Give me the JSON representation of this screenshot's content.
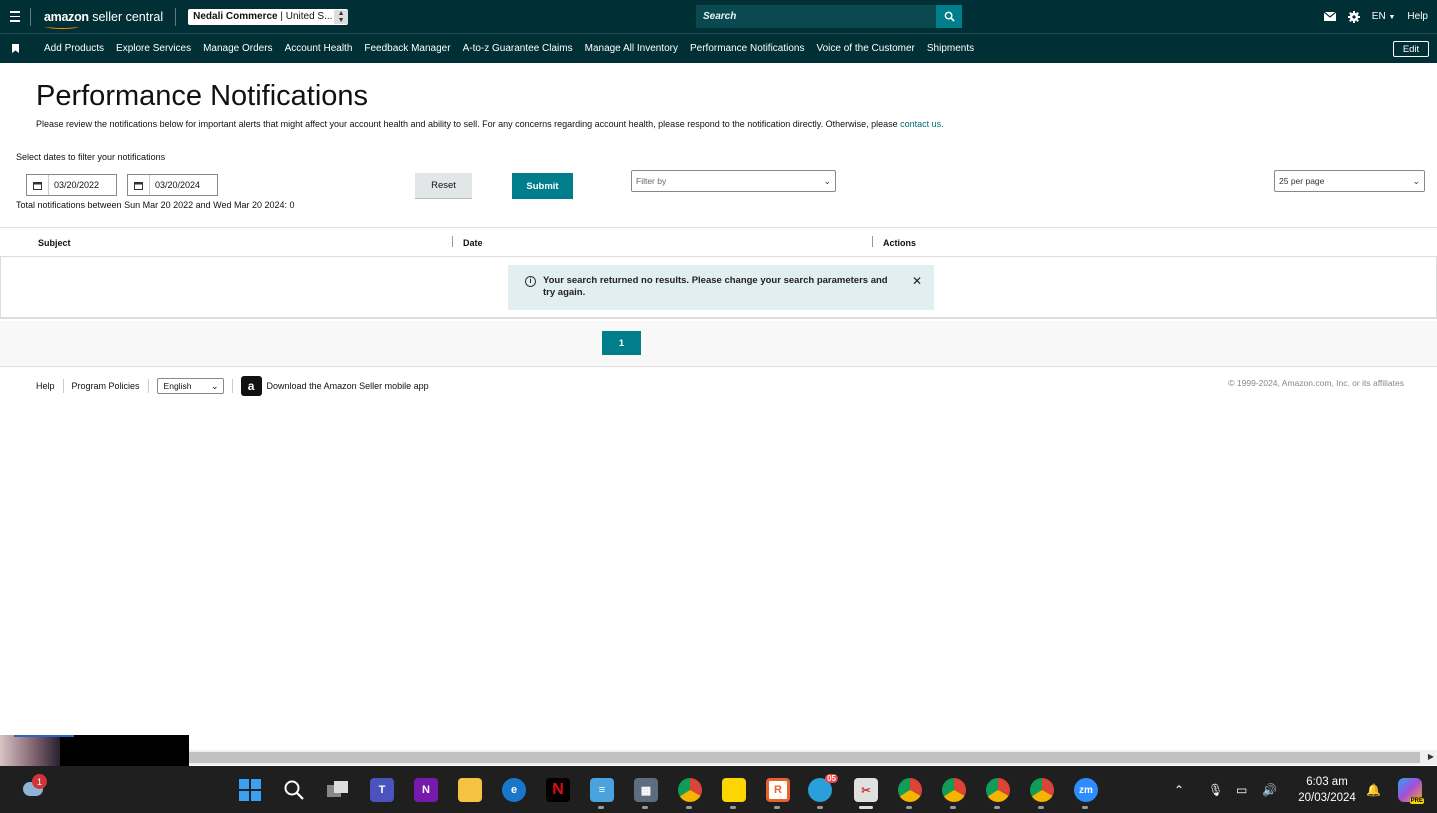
{
  "topbar": {
    "logo_brand": "amazon",
    "logo_product": "seller central",
    "store_name": "Nedali Commerce",
    "store_region": "United S...",
    "search_placeholder": "Search",
    "language": "EN",
    "help": "Help"
  },
  "nav": {
    "items": [
      "Add Products",
      "Explore Services",
      "Manage Orders",
      "Account Health",
      "Feedback Manager",
      "A-to-z Guarantee Claims",
      "Manage All Inventory",
      "Performance Notifications",
      "Voice of the Customer",
      "Shipments"
    ],
    "edit": "Edit"
  },
  "page": {
    "title": "Performance Notifications",
    "description": "Please review the notifications below for important alerts that might affect your account health and ability to sell. For any concerns regarding account health, please respond to the notification directly. Otherwise, please",
    "contact_link": "contact us.",
    "filter_label": "Select dates to filter your notifications",
    "start_date": "03/20/2022",
    "end_date": "03/20/2024",
    "reset": "Reset",
    "submit": "Submit",
    "filter_by": "Filter by",
    "per_page": "25 per page",
    "total": "Total notifications between Sun Mar 20 2022 and Wed Mar 20 2024: 0"
  },
  "table": {
    "columns": [
      "Subject",
      "Date",
      "Actions"
    ],
    "empty_message": "Your search returned no results. Please change your search parameters and try again."
  },
  "pagination": {
    "current": "1"
  },
  "footer": {
    "help": "Help",
    "program_policies": "Program Policies",
    "language": "English",
    "app_icon_letter": "a",
    "download_app": "Download the Amazon Seller mobile app",
    "copyright": "© 1999-2024, Amazon.com, Inc. or its affiliates"
  },
  "taskbar": {
    "weather_badge": "1",
    "telegram_badge": "05",
    "time": "6:03 am",
    "date": "20/03/2024",
    "copilot_badge": "PRE"
  },
  "colors": {
    "header_bg": "#002f36",
    "accent": "#007e8b",
    "alert_bg": "#e2eff0"
  }
}
